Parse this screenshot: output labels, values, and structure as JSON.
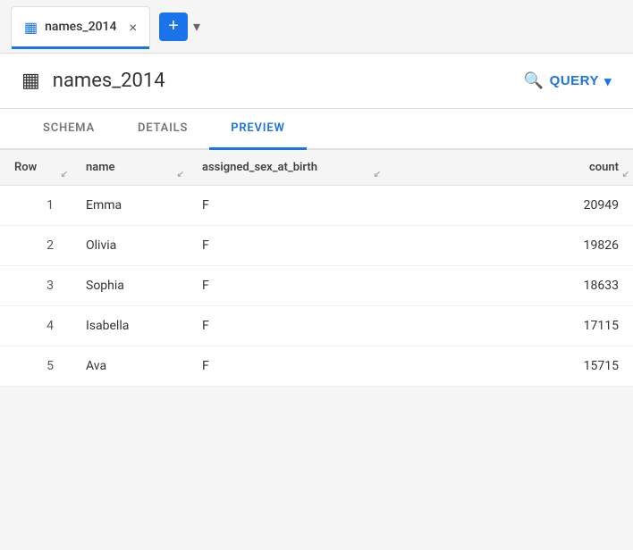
{
  "tab": {
    "icon": "▦",
    "label": "names_2014",
    "close": "×",
    "add_label": "+",
    "dropdown": "▾"
  },
  "header": {
    "icon": "▦",
    "title": "names_2014",
    "query_label": "QUERY",
    "query_icon": "🔍",
    "dropdown": "▾"
  },
  "nav_tabs": [
    {
      "label": "SCHEMA",
      "active": false
    },
    {
      "label": "DETAILS",
      "active": false
    },
    {
      "label": "PREVIEW",
      "active": true
    }
  ],
  "table": {
    "columns": [
      {
        "key": "row",
        "label": "Row"
      },
      {
        "key": "name",
        "label": "name"
      },
      {
        "key": "sex",
        "label": "assigned_sex_at_birth"
      },
      {
        "key": "count",
        "label": "count"
      }
    ],
    "rows": [
      {
        "row": "1",
        "name": "Emma",
        "sex": "F",
        "count": "20949"
      },
      {
        "row": "2",
        "name": "Olivia",
        "sex": "F",
        "count": "19826"
      },
      {
        "row": "3",
        "name": "Sophia",
        "sex": "F",
        "count": "18633"
      },
      {
        "row": "4",
        "name": "Isabella",
        "sex": "F",
        "count": "17115"
      },
      {
        "row": "5",
        "name": "Ava",
        "sex": "F",
        "count": "15715"
      }
    ]
  },
  "colors": {
    "accent": "#1a73e8",
    "text_primary": "#333",
    "text_muted": "#777",
    "border": "#e0e0e0",
    "bg_light": "#f5f5f5"
  }
}
